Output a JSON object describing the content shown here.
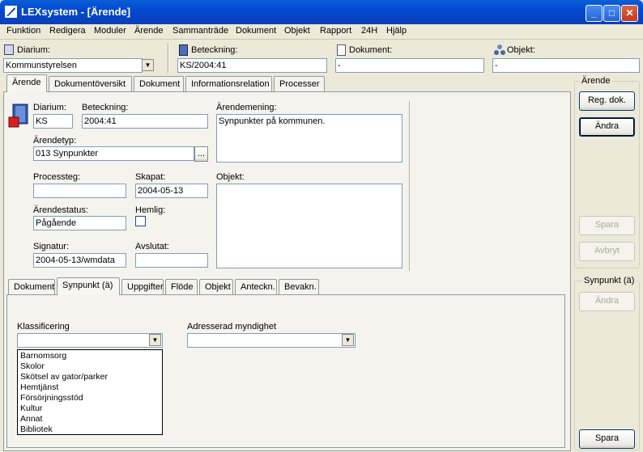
{
  "window": {
    "title": "LEXsystem - [Ärende]"
  },
  "menu": [
    "Funktion",
    "Redigera",
    "Moduler",
    "Ärende",
    "Sammanträde",
    "Dokument",
    "Objekt",
    "Rapport",
    "24H",
    "Hjälp"
  ],
  "toolbar": {
    "diarium_label": "Diarium:",
    "diarium_value": "Kommunstyrelsen",
    "beteckning_label": "Beteckning:",
    "beteckning_value": "KS/2004:41",
    "dokument_label": "Dokument:",
    "dokument_value": "-",
    "objekt_label": "Objekt:",
    "objekt_value": "-"
  },
  "main_tabs": [
    "Ärende",
    "Dokumentöversikt",
    "Dokument",
    "Informationsrelation",
    "Processer"
  ],
  "arende": {
    "diarium_label": "Diarium:",
    "diarium_value": "KS",
    "beteckning_label": "Beteckning:",
    "beteckning_value": "2004:41",
    "arendemening_label": "Ärendemening:",
    "arendemening_value": "Synpunkter på kommunen.",
    "arendetyp_label": "Ärendetyp:",
    "arendetyp_value": "013 Synpunkter",
    "browse_label": "...",
    "processteg_label": "Processteg:",
    "processteg_value": "",
    "skapat_label": "Skapat:",
    "skapat_value": "2004-05-13",
    "objekt_label": "Objekt:",
    "arendestatus_label": "Ärendestatus:",
    "arendestatus_value": "Pågående",
    "hemlig_label": "Hemlig:",
    "signatur_label": "Signatur:",
    "signatur_value": "2004-05-13/wmdata",
    "avslutat_label": "Avslutat:",
    "avslutat_value": ""
  },
  "sub_tabs": [
    "Dokument",
    "Synpunkt (ä)",
    "Uppgifter",
    "Flöde",
    "Objekt",
    "Anteckn.",
    "Bevakn."
  ],
  "synpunkt": {
    "klassificering_label": "Klassificering",
    "klassificering_value": "",
    "adresserad_label": "Adresserad myndighet",
    "adresserad_value": "",
    "options": [
      "Barnomsorg",
      "Skolor",
      "Skötsel av gator/parker",
      "Hemtjänst",
      "Försörjningsstöd",
      "Kultur",
      "Annat",
      "Bibliotek"
    ]
  },
  "right_panel": {
    "arende_group": "Ärende",
    "reg_dok": "Reg. dok.",
    "andra": "Ändra",
    "spara": "Spara",
    "avbryt": "Avbryt",
    "synpunkt_group": "Synpunkt (ä)",
    "andra2": "Ändra",
    "spara2": "Spara"
  }
}
